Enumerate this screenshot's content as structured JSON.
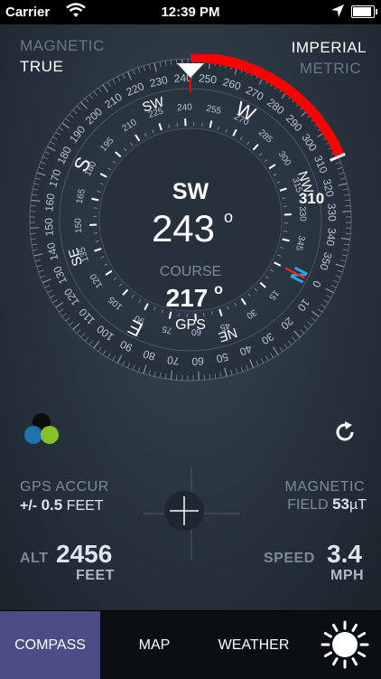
{
  "status_bar": {
    "carrier": "Carrier",
    "time": "12:39 PM"
  },
  "reference_toggle": {
    "magnetic": "MAGNETIC",
    "true": "TRUE"
  },
  "units_toggle": {
    "imperial": "IMPERIAL",
    "metric": "METRIC"
  },
  "compass": {
    "heading_dir": "SW",
    "heading_deg": "243",
    "degree_symbol": "o",
    "course_label": "COURSE",
    "course_deg": "217",
    "course_source": "GPS",
    "bearing_marker": "310",
    "outer_labels": [
      "0",
      "10",
      "20",
      "30",
      "40",
      "50",
      "60",
      "70",
      "80",
      "90",
      "100",
      "110",
      "120",
      "130",
      "140",
      "150",
      "160",
      "170",
      "180",
      "190",
      "200",
      "210",
      "220",
      "230",
      "240",
      "250",
      "260",
      "270",
      "280",
      "290",
      "300",
      "310",
      "320",
      "330",
      "340",
      "350"
    ],
    "inner_labels": [
      "15",
      "30",
      "45",
      "60",
      "75",
      "90",
      "105",
      "120",
      "135",
      "150",
      "165",
      "180",
      "195",
      "210",
      "225",
      "240",
      "255",
      "270",
      "285",
      "300",
      "315",
      "330",
      "345"
    ],
    "cardinals": {
      "n": "N",
      "ne": "NE",
      "e": "E",
      "se": "SE",
      "s": "S",
      "sw": "SW",
      "w": "W",
      "nw": "NW"
    },
    "accent_color": "#ff0000",
    "north_color": "#2aa6e8"
  },
  "gps_accuracy": {
    "label": "GPS  ACCUR",
    "prefix": "+/-",
    "value": "0.5",
    "unit": "FEET"
  },
  "magnetic_field": {
    "label": "MAGNETIC",
    "label2": "FIELD",
    "value": "53",
    "unit": "µT"
  },
  "altitude": {
    "label": "ALT",
    "value": "2456",
    "unit": "FEET"
  },
  "speed": {
    "label": "SPEED",
    "value": "3.4",
    "unit": "MPH"
  },
  "tabs": [
    {
      "label": "COMPASS"
    },
    {
      "label": "MAP"
    },
    {
      "label": "WEATHER"
    }
  ]
}
